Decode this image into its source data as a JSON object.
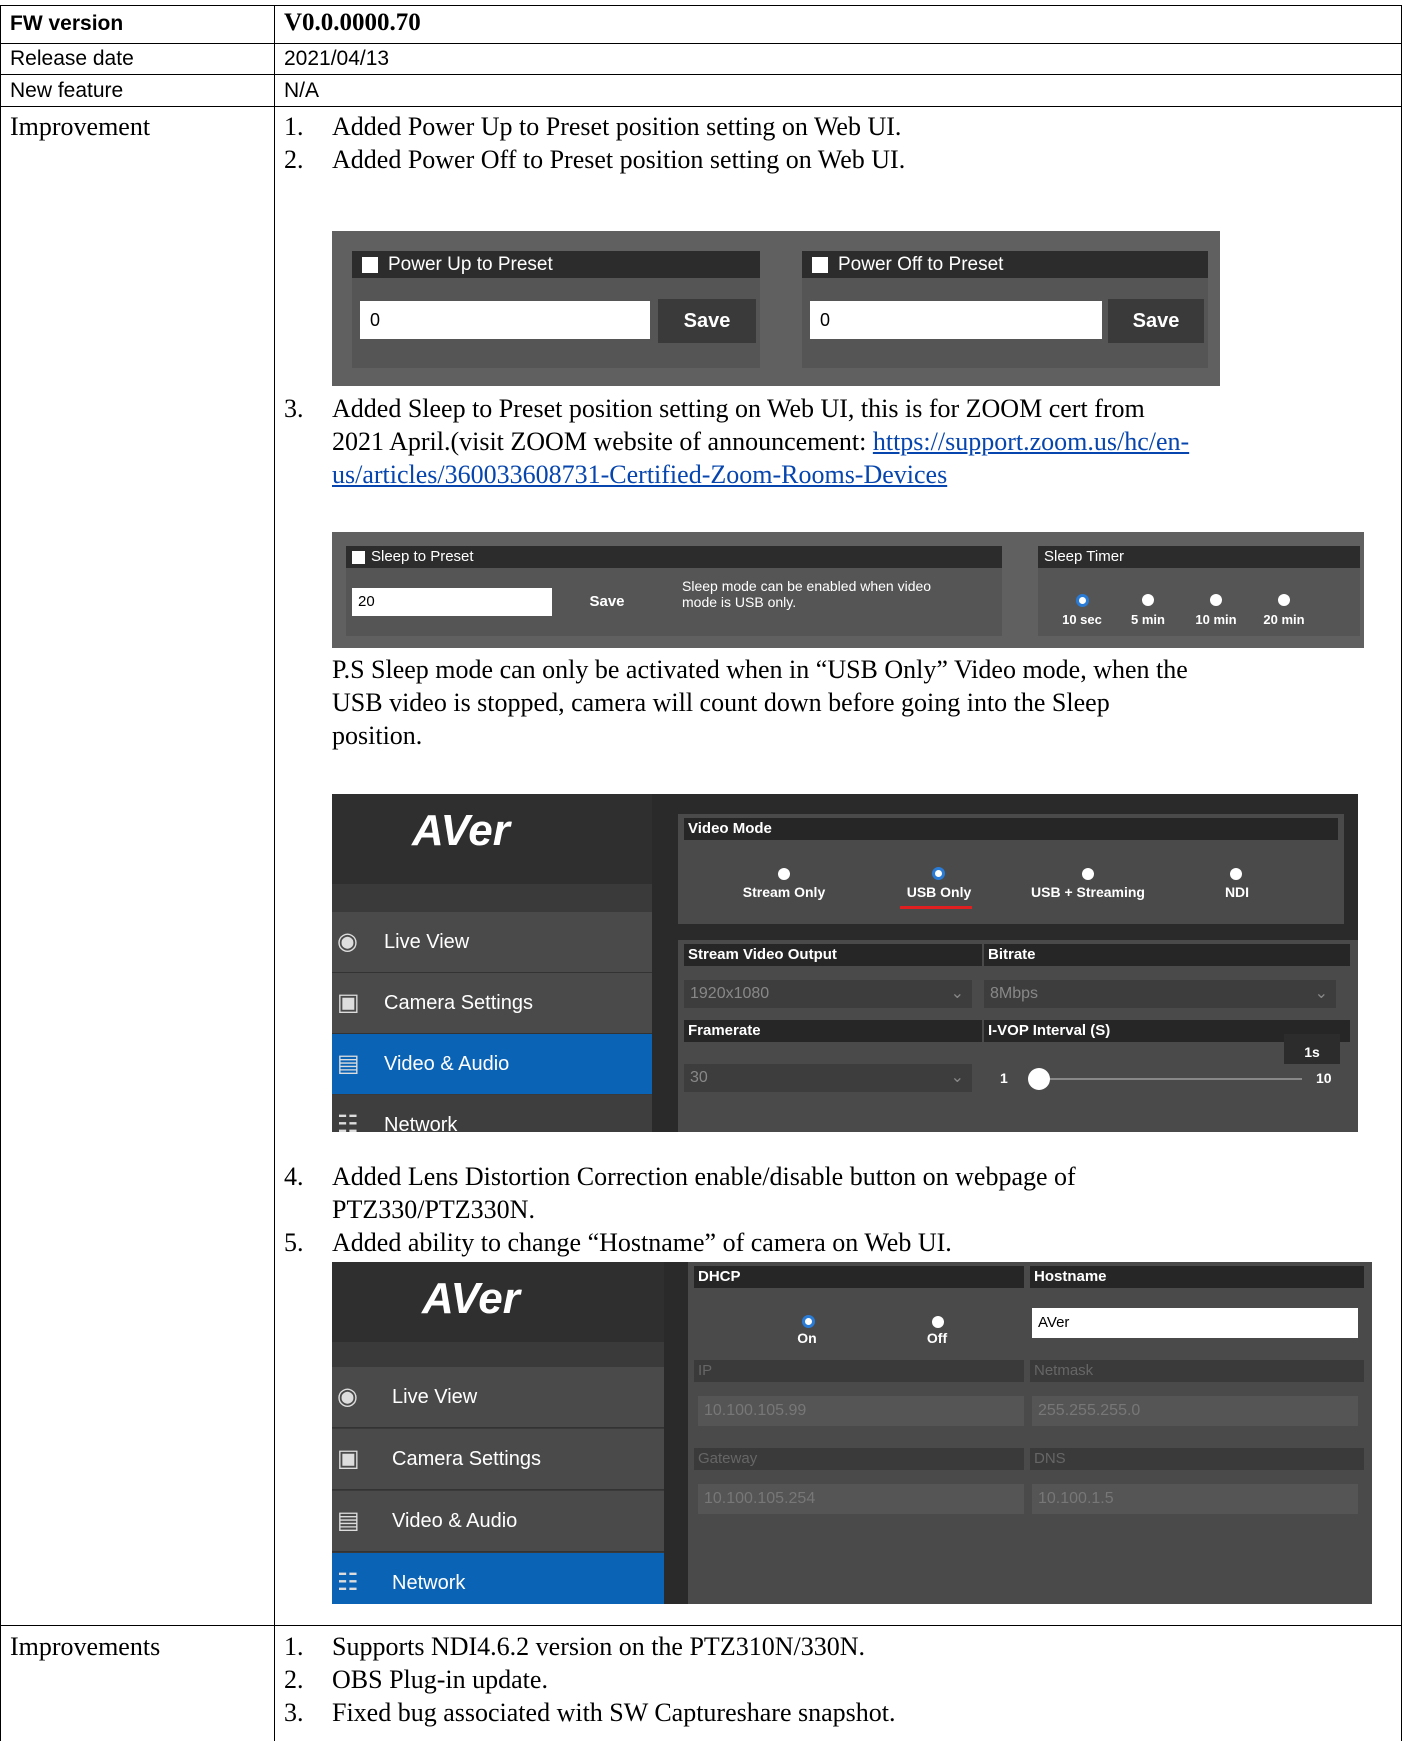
{
  "table": {
    "fw_label": "FW version",
    "fw_value": "V0.0.0000.70",
    "release_label": "Release date",
    "release_value": "2021/04/13",
    "feature_label": "New feature",
    "feature_value": "N/A",
    "improvement_label": "Improvement",
    "improvements_label": "Improvements"
  },
  "improvement": {
    "items": [
      {
        "num": "1.",
        "text": "Added Power Up to Preset position setting on Web UI."
      },
      {
        "num": "2.",
        "text": "Added Power Off to Preset position setting on Web UI."
      }
    ],
    "item3_num": "3.",
    "item3_line1": "Added Sleep to Preset position setting on Web UI, this is for ZOOM cert from",
    "item3_line2": "2021 April.(visit ZOOM website of announcement: ",
    "item3_link1": "https://support.zoom.us/hc/en-",
    "item3_link2": "us/articles/360033608731-Certified-Zoom-Rooms-Devices",
    "ps_line1": "P.S Sleep mode can only be activated when in “USB Only” Video mode, when the",
    "ps_line2": "USB video is stopped, camera will count down before going into the Sleep",
    "ps_line3": "position.",
    "item4_num": "4.",
    "item4_line1": "Added Lens Distortion Correction enable/disable button on webpage of",
    "item4_line2": "PTZ330/PTZ330N.",
    "item5_num": "5.",
    "item5_text": "Added ability to change “Hostname” of camera on Web UI."
  },
  "improvements": [
    {
      "num": "1.",
      "text": "Supports NDI4.6.2 version on the PTZ310N/330N."
    },
    {
      "num": "2.",
      "text": "OBS Plug-in update."
    },
    {
      "num": "3.",
      "text": "Fixed bug associated with SW Captureshare snapshot."
    }
  ],
  "power_ui": {
    "up_label": "Power Up to Preset",
    "up_value": "0",
    "off_label": "Power Off to Preset",
    "off_value": "0",
    "save": "Save"
  },
  "sleep_ui": {
    "label": "Sleep to Preset",
    "value": "20",
    "save": "Save",
    "note_line1": "Sleep mode can be enabled when video",
    "note_line2": "mode is USB only.",
    "timer_label": "Sleep Timer",
    "options": [
      "10 sec",
      "5 min",
      "10 min",
      "20 min"
    ],
    "selected": "10 sec"
  },
  "video_ui": {
    "logo": "AVer",
    "sidebar": [
      "Live View",
      "Camera Settings",
      "Video & Audio",
      "Network"
    ],
    "active": "Video & Audio",
    "mode_label": "Video Mode",
    "modes": [
      "Stream Only",
      "USB Only",
      "USB + Streaming",
      "NDI"
    ],
    "mode_selected": "USB Only",
    "stream_output_label": "Stream Video Output",
    "stream_output_value": "1920x1080",
    "bitrate_label": "Bitrate",
    "bitrate_value": "8Mbps",
    "framerate_label": "Framerate",
    "framerate_value": "30",
    "ivop_label": "I-VOP Interval (S)",
    "ivop_badge": "1s",
    "ivop_min": "1",
    "ivop_max": "10",
    "ivop_value": 1
  },
  "network_ui": {
    "logo": "AVer",
    "sidebar": [
      "Live View",
      "Camera Settings",
      "Video & Audio",
      "Network"
    ],
    "active": "Network",
    "dhcp_label": "DHCP",
    "dhcp_on": "On",
    "dhcp_off": "Off",
    "dhcp_selected": "On",
    "hostname_label": "Hostname",
    "hostname_value": "AVer",
    "ip_label": "IP",
    "ip_value": "10.100.105.99",
    "netmask_label": "Netmask",
    "netmask_value": "255.255.255.0",
    "gateway_label": "Gateway",
    "gateway_value": "10.100.105.254",
    "dns_label": "DNS",
    "dns_value": "10.100.1.5"
  },
  "colors": {
    "active_nav": "#0b63b6",
    "radio_selected": "#2a7bd6",
    "underline_red": "#e02020",
    "link": "#0645ad"
  }
}
